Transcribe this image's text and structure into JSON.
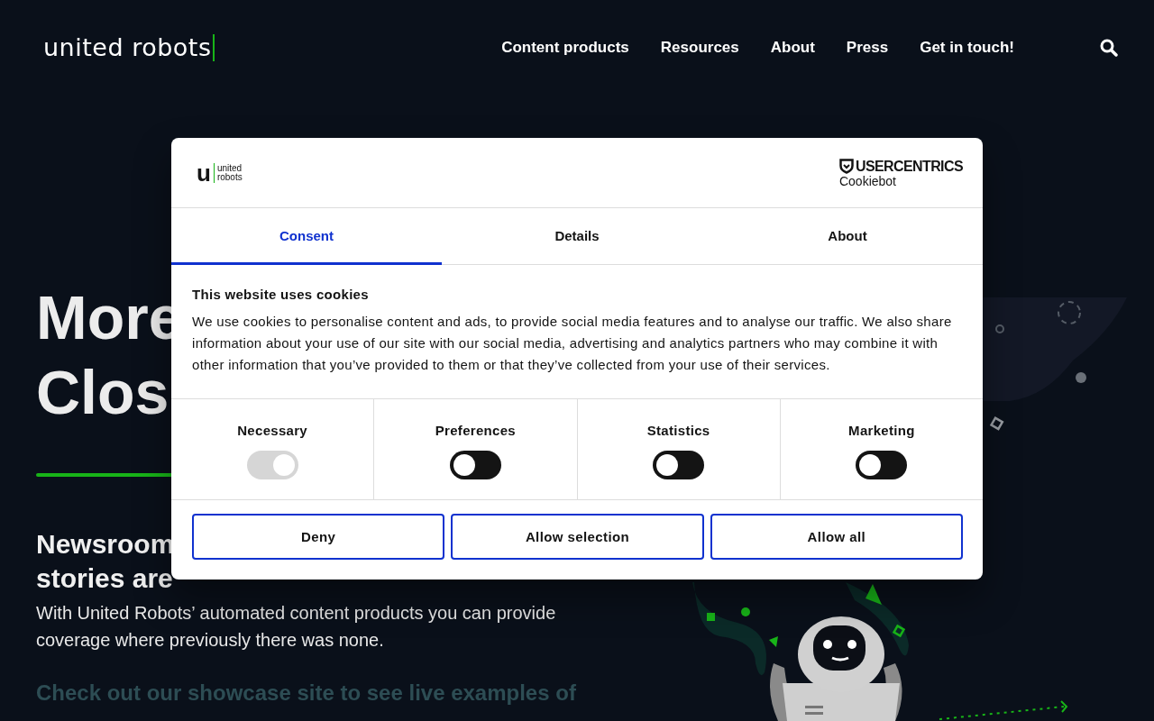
{
  "header": {
    "logo": "united robots",
    "nav": [
      {
        "label": "Content products"
      },
      {
        "label": "Resources"
      },
      {
        "label": "About"
      },
      {
        "label": "Press"
      },
      {
        "label": "Get in touch!"
      }
    ]
  },
  "hero": {
    "title_lines": [
      "More",
      "Clos"
    ],
    "subtitle_lines": [
      "Newsroom",
      "stories are"
    ],
    "text": "With United Robots’ automated content products you can provide coverage where previously there was none.",
    "link_line": "Check out our showcase site to see live examples of"
  },
  "cookie_dialog": {
    "logo_letter": "u",
    "logo_lines": [
      "united",
      "robots"
    ],
    "brand": "USERCENTRICS",
    "brand_sub": "Cookiebot",
    "tabs": [
      {
        "label": "Consent",
        "selected": true
      },
      {
        "label": "Details",
        "selected": false
      },
      {
        "label": "About",
        "selected": false
      }
    ],
    "title": "This website uses cookies",
    "text": "We use cookies to personalise content and ads, to provide social media features and to analyse our traffic. We also share information about your use of our site with our social media, advertising and analytics partners who may combine it with other information that you’ve provided to them or that they’ve collected from your use of their services.",
    "categories": [
      {
        "label": "Necessary",
        "checked": true,
        "disabled": true
      },
      {
        "label": "Preferences",
        "checked": false,
        "disabled": false
      },
      {
        "label": "Statistics",
        "checked": false,
        "disabled": false
      },
      {
        "label": "Marketing",
        "checked": false,
        "disabled": false
      }
    ],
    "buttons": [
      "Deny",
      "Allow selection",
      "Allow all"
    ]
  }
}
